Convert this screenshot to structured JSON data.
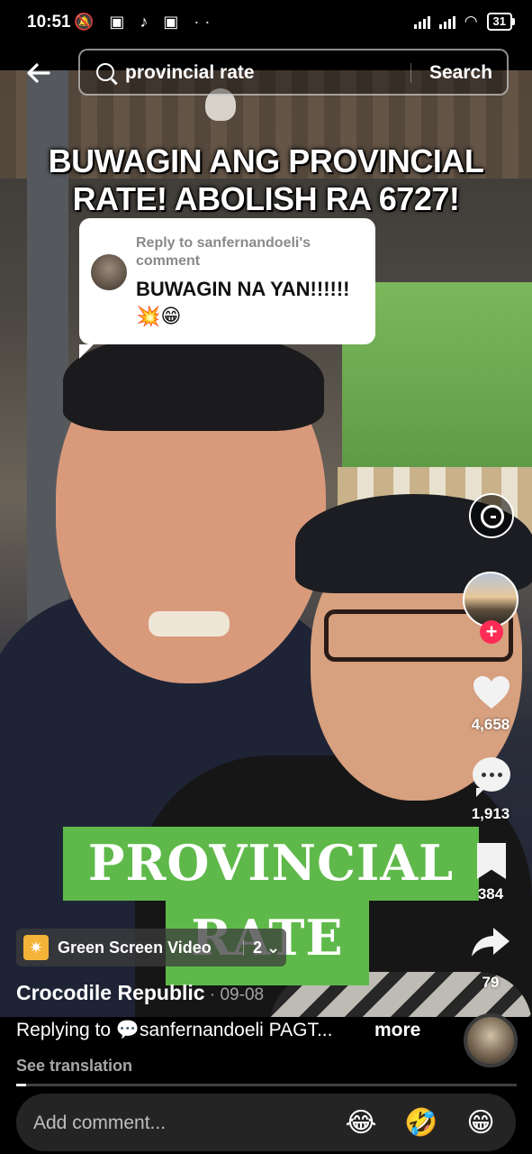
{
  "status_bar": {
    "time": "10:51",
    "notification_icons": "🔕 ▣ ♪ ▣ ··",
    "battery": "31"
  },
  "search": {
    "query": "provincial rate",
    "button_label": "Search"
  },
  "video": {
    "headline": "BUWAGIN ANG PROVINCIAL RATE! ABOLISH RA 6727!",
    "reply_meta": "Reply to sanfernandoeli's comment",
    "reply_message": "BUWAGIN NA YAN!!!!!! 💥😁",
    "sticker_line1": "PROVINCIAL",
    "sticker_line2": "RATE"
  },
  "rail": {
    "likes": "4,658",
    "comments": "1,913",
    "saves": "384",
    "shares": "79",
    "follow_symbol": "+"
  },
  "effect": {
    "icon": "✷",
    "label": "Green Screen Video",
    "count": "2 ⌄"
  },
  "post": {
    "author": "Crocodile Republic",
    "date": " · 09-08",
    "caption_prefix": "Replying to ",
    "caption_mention": "💬sanfernandoeli",
    "caption_text": "  PAGT...",
    "more_label": "more",
    "see_translation": "See translation",
    "progress_fraction": 0.02
  },
  "comment_bar": {
    "placeholder": "Add comment...",
    "emojis": [
      "😂",
      "🤣",
      "😁"
    ]
  },
  "colors": {
    "accent_follow": "#fe2c55",
    "sticker_green": "#5fb94a"
  }
}
